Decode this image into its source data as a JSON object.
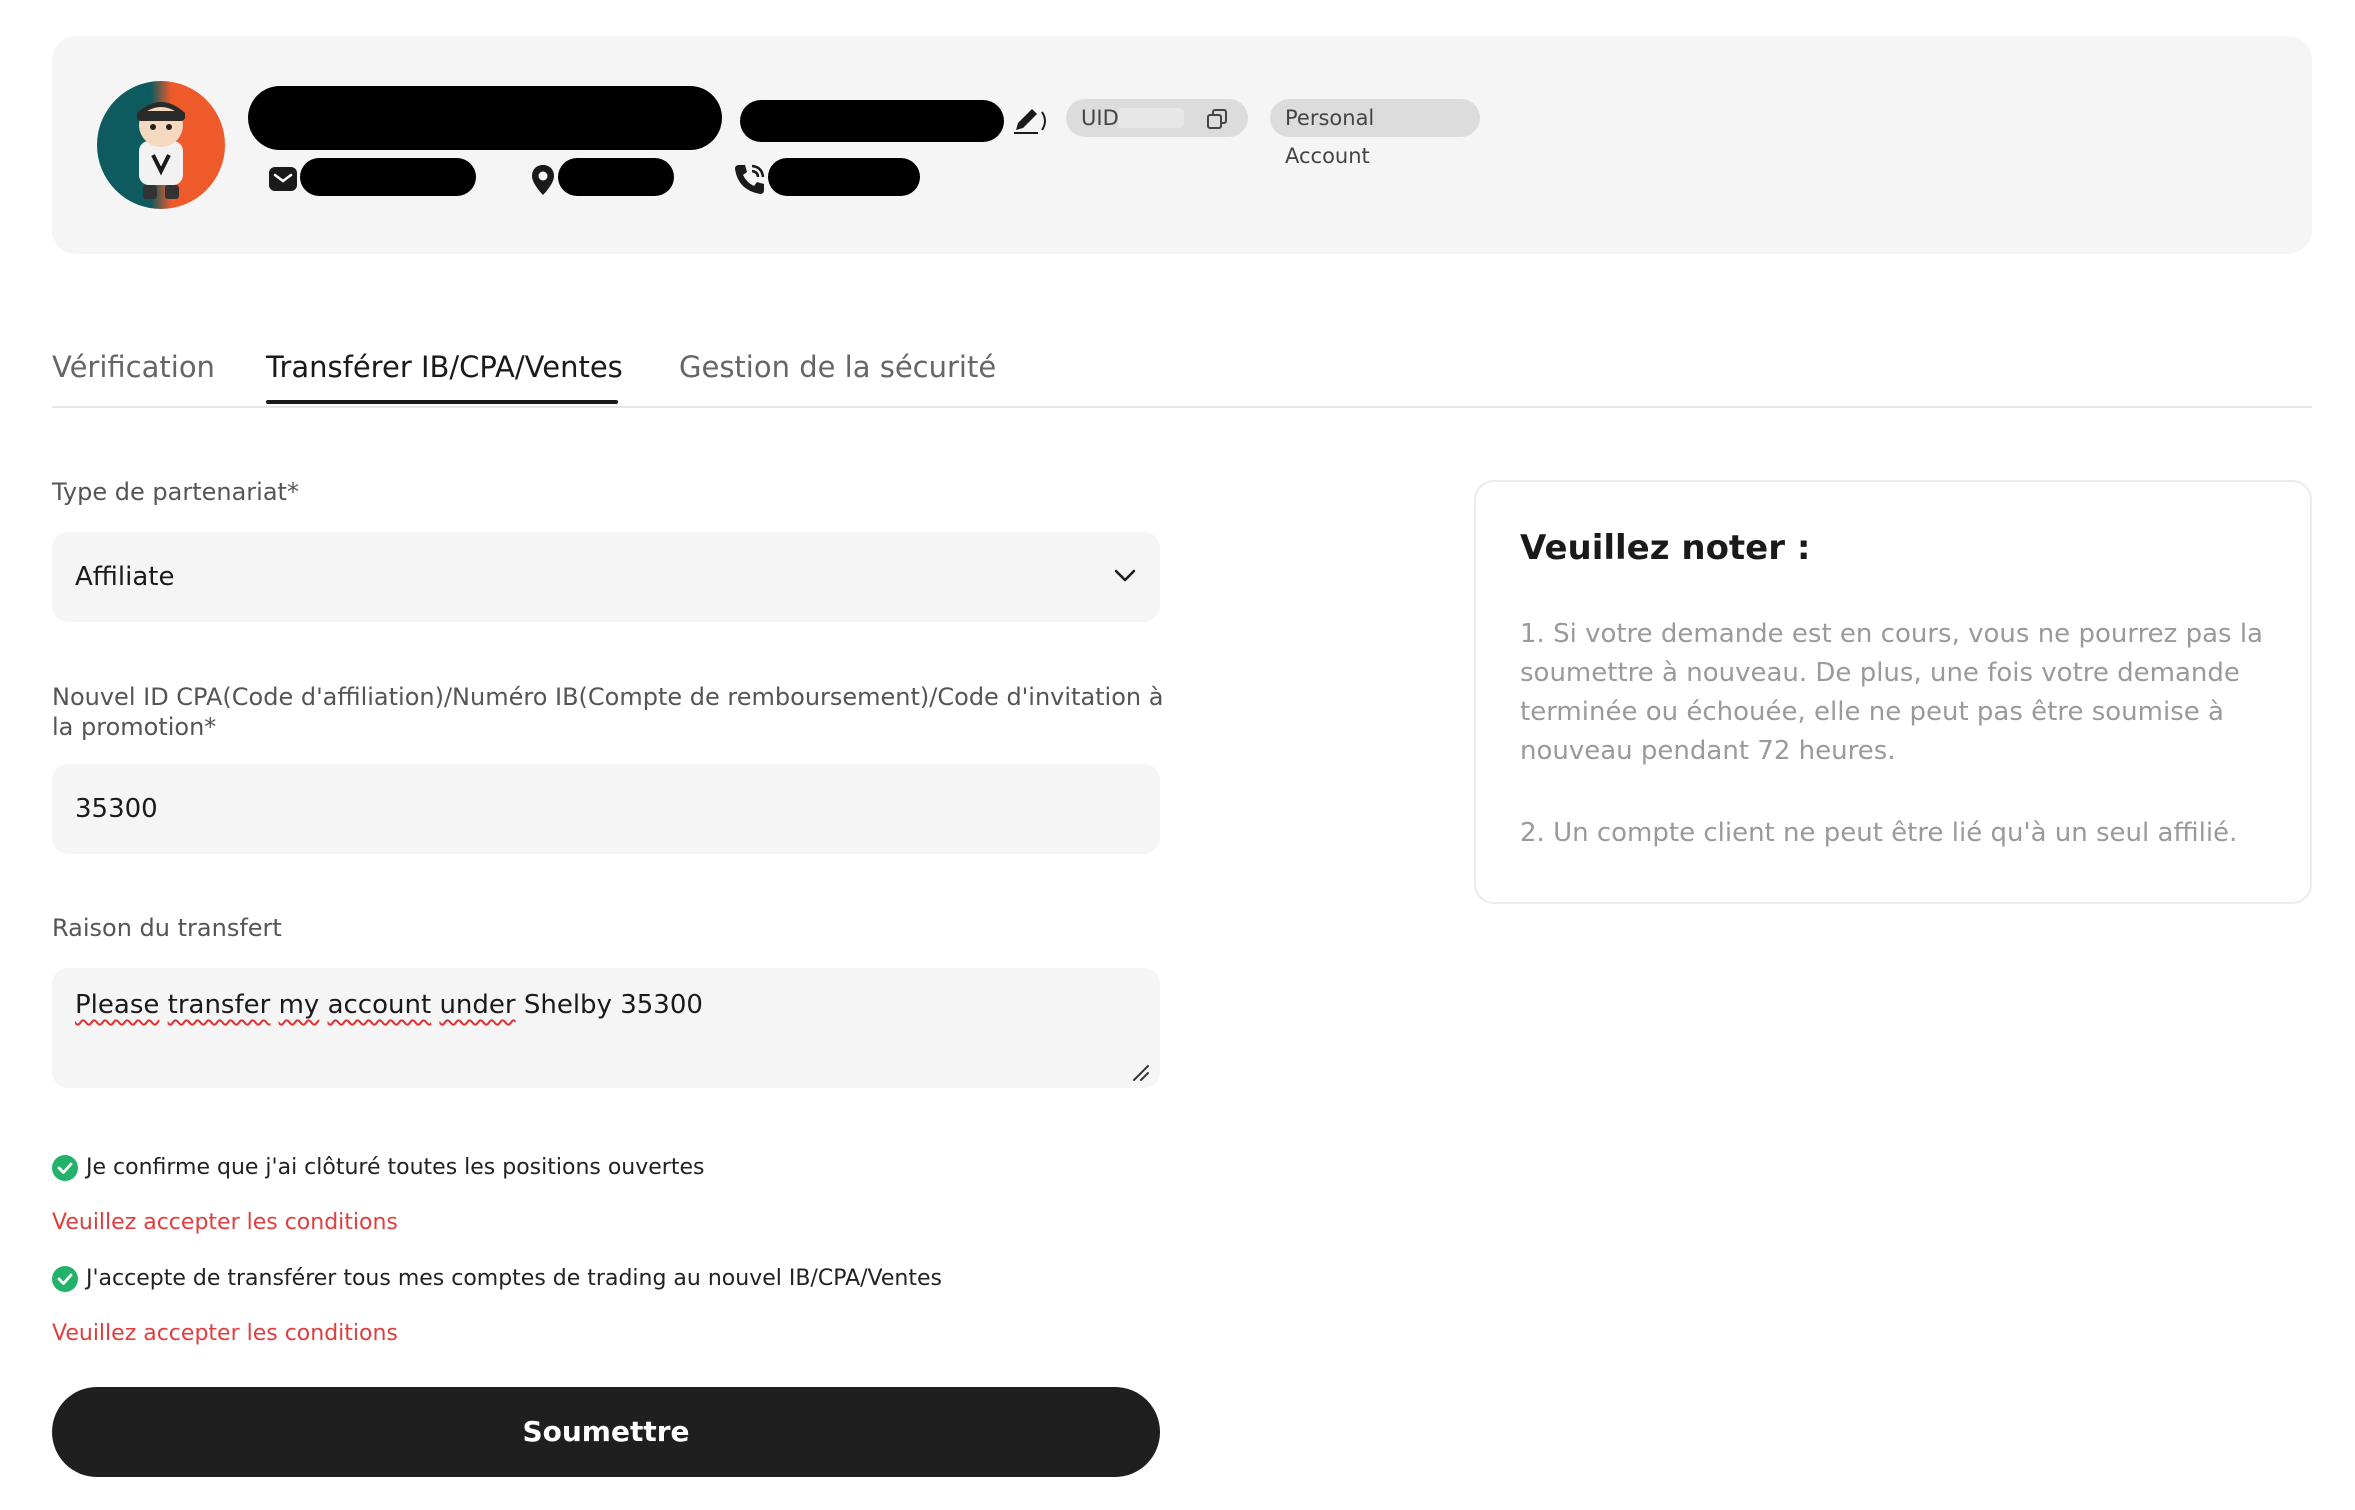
{
  "profile": {
    "uid_label": "UID",
    "account_type": "Personal Account"
  },
  "tabs": [
    {
      "label": "Vérification",
      "active": false
    },
    {
      "label": "Transférer IB/CPA/Ventes",
      "active": true
    },
    {
      "label": "Gestion de la sécurité",
      "active": false
    }
  ],
  "form": {
    "partnership_label": "Type de partenariat*",
    "partnership_value": "Affiliate",
    "id_label": "Nouvel ID CPA(Code d'affiliation)/Numéro IB(Compte de remboursement)/Code d'invitation à la promotion*",
    "id_value": "35300",
    "reason_label": "Raison du transfert",
    "reason_words": [
      "Please",
      "transfer",
      "my",
      "account",
      "under"
    ],
    "reason_rest": "Shelby 35300",
    "confirm1": "Je confirme que j'ai clôturé toutes les positions ouvertes",
    "error1": "Veuillez accepter les conditions",
    "confirm2": "J'accepte de transférer tous mes comptes de trading au nouvel IB/CPA/Ventes",
    "error2": "Veuillez accepter les conditions",
    "submit_label": "Soumettre"
  },
  "notice": {
    "title": "Veuillez noter :",
    "item1": "1. Si votre demande est en cours, vous ne pourrez pas la soumettre à nouveau. De plus, une fois votre demande terminée ou échouée, elle ne peut pas être soumise à nouveau pendant 72 heures.",
    "item2": "2. Un compte client ne peut être lié qu'à un seul affilié."
  },
  "colors": {
    "accent": "#1f1f1f",
    "error": "#e03e3e",
    "success": "#24b26b"
  }
}
